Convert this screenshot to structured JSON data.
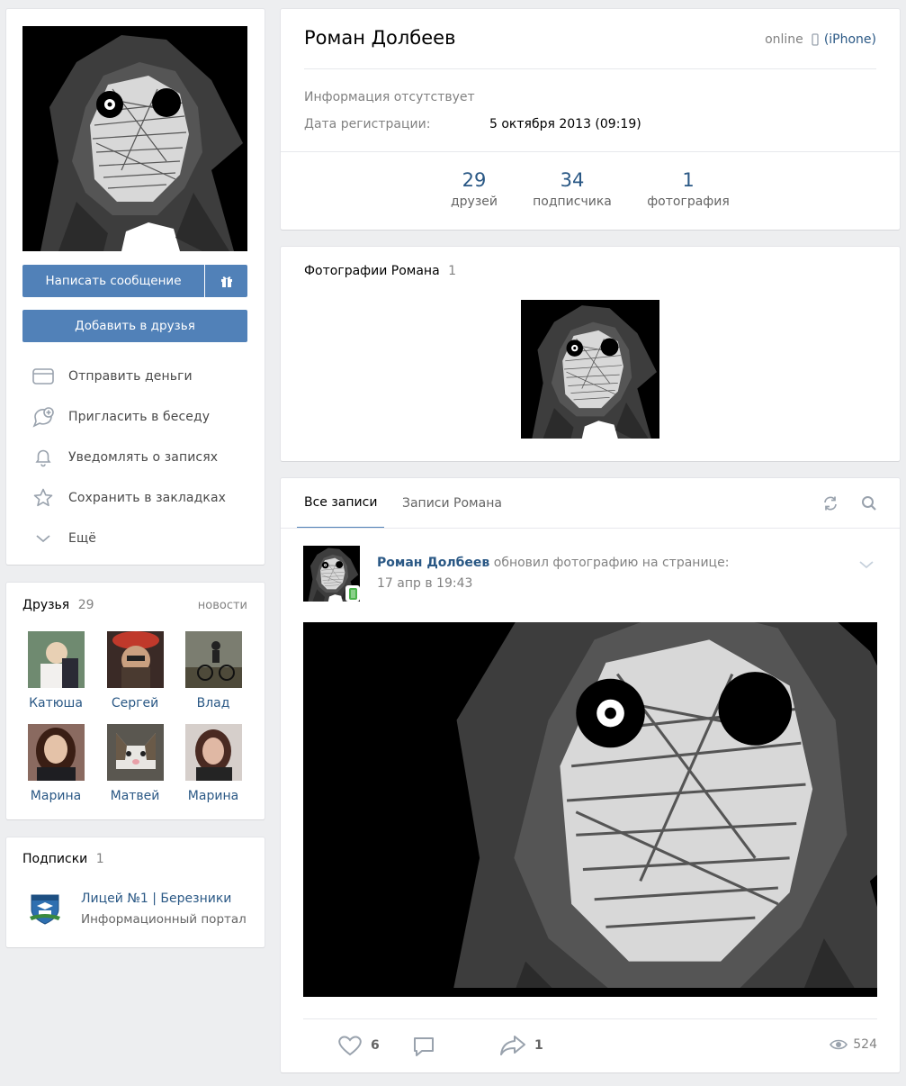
{
  "profile": {
    "name": "Роман Долбеев",
    "online_label": "online",
    "device": "(iPhone)",
    "info_missing": "Информация отсутствует",
    "reg_label": "Дата регистрации:",
    "reg_date": "5 октября 2013 (09:19)"
  },
  "counters": [
    {
      "num": "29",
      "label": "друзей"
    },
    {
      "num": "34",
      "label": "подписчика"
    },
    {
      "num": "1",
      "label": "фотография"
    }
  ],
  "actions": {
    "message": "Написать сообщение",
    "add_friend": "Добавить в друзья",
    "menu": [
      {
        "label": "Отправить деньги",
        "icon": "card-icon"
      },
      {
        "label": "Пригласить в беседу",
        "icon": "chat-plus-icon"
      },
      {
        "label": "Уведомлять о записях",
        "icon": "bell-icon"
      },
      {
        "label": "Сохранить в закладках",
        "icon": "star-icon"
      },
      {
        "label": "Ещё",
        "icon": "chevron-down-icon"
      }
    ]
  },
  "friends": {
    "title": "Друзья",
    "count": "29",
    "news_link": "новости",
    "items": [
      {
        "name": "Катюша",
        "color": "#8f7f6c"
      },
      {
        "name": "Сергей",
        "color": "#7a3d34"
      },
      {
        "name": "Влад",
        "color": "#5d5a4f"
      },
      {
        "name": "Марина",
        "color": "#6b3b2f"
      },
      {
        "name": "Матвей",
        "color": "#b8b0a6"
      },
      {
        "name": "Марина",
        "color": "#9a7266"
      }
    ]
  },
  "subscriptions": {
    "title": "Подписки",
    "count": "1",
    "item_name": "Лицей №1 | Березники",
    "item_desc": "Информационный портал"
  },
  "photos": {
    "title": "Фотографии Романа",
    "count": "1"
  },
  "wall": {
    "tab_all": "Все записи",
    "tab_own": "Записи Романа",
    "post": {
      "author": "Роман Долбеев",
      "action": "обновил фотографию на странице:",
      "date": "17 апр в 19:43",
      "likes": "6",
      "shares": "1",
      "views": "524"
    }
  },
  "colors": {
    "accent": "#5181b8",
    "link": "#2a5885",
    "background": "#edeef0"
  }
}
